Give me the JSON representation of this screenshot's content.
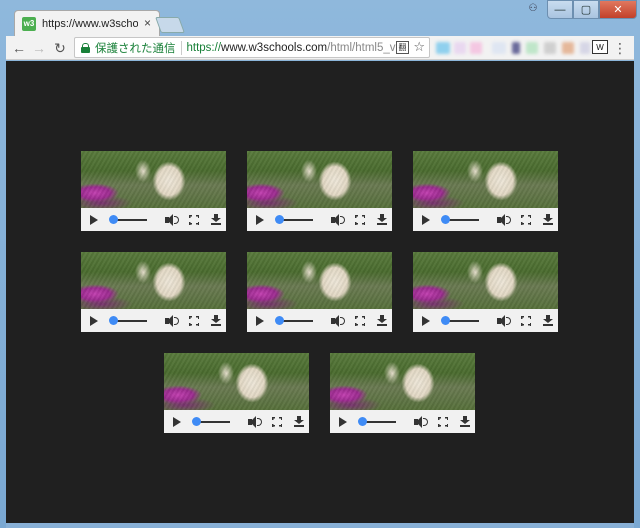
{
  "window": {
    "tab_title": "https://www.w3schoo",
    "tab_close": "×",
    "favicon_text": "w3",
    "controls": {
      "minimize": "—",
      "maximize": "▢",
      "close": "✕",
      "user": "⚇"
    }
  },
  "toolbar": {
    "back": "←",
    "forward": "→",
    "reload": "↻",
    "secure_label": "保護された通信",
    "url_scheme": "https://",
    "url_host": "www.w3schools.com",
    "url_path": "/html/html5_v",
    "translate_icon": "翻",
    "star_icon": "☆",
    "ext_icon": "W",
    "menu_icon": "⋮"
  },
  "colors": {
    "page_background": "#202020",
    "secure_green": "#188038",
    "seek_knob": "#3f8bf5",
    "controls_bar": "#f1f1f1"
  },
  "videos": [
    {
      "id": "video-1"
    },
    {
      "id": "video-2"
    },
    {
      "id": "video-3"
    },
    {
      "id": "video-4"
    },
    {
      "id": "video-5"
    },
    {
      "id": "video-6"
    },
    {
      "id": "video-7"
    },
    {
      "id": "video-8"
    }
  ]
}
